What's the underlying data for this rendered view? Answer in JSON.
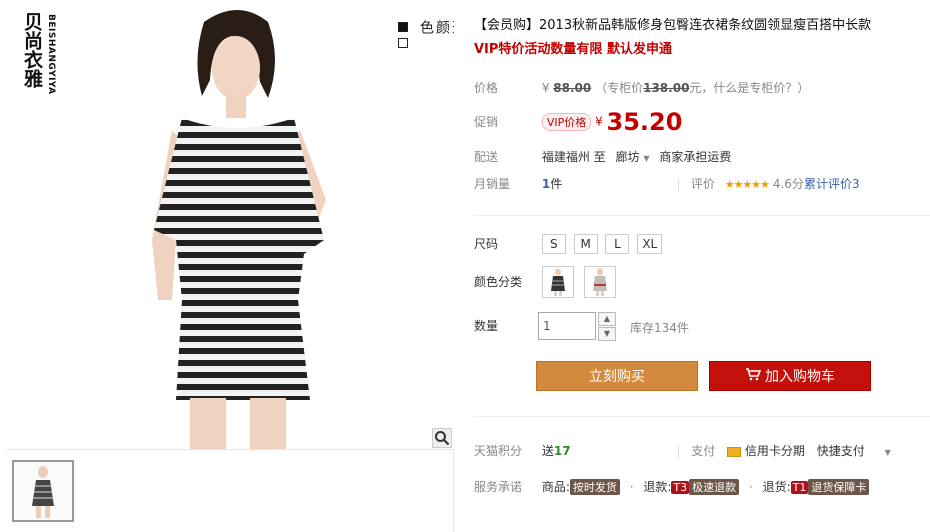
{
  "gallery": {
    "brand_cn": "贝尚衣雅",
    "brand_en": "BEISHANGYIYA",
    "option_text": "可选颜色"
  },
  "product": {
    "title": "【会员购】2013秋新品韩版修身包臀连衣裙条纹圆领显瘦百搭中长款",
    "subtitle": "VIP特价活动数量有限 默认发申通"
  },
  "price": {
    "label": "价格",
    "currency": "¥",
    "original": "88.00",
    "counter_prefix": "（专柜价",
    "counter_value": "138.00",
    "counter_suffix": "元，什么是专柜价？）"
  },
  "promo": {
    "label": "促销",
    "tag": "VIP价格",
    "currency": "¥",
    "price": "35.20"
  },
  "shipping": {
    "label": "配送",
    "from": "福建福州",
    "to_word": "至",
    "to": "廊坊",
    "fee": "商家承担运费"
  },
  "sales": {
    "label": "月销量",
    "count": "1",
    "unit": "件",
    "review_label": "评价",
    "rating": 4.6,
    "rating_text": "4.6分",
    "review_text": "累计评价3"
  },
  "size": {
    "label": "尺码",
    "options": [
      "S",
      "M",
      "L",
      "XL"
    ]
  },
  "color": {
    "label": "颜色分类"
  },
  "quantity": {
    "label": "数量",
    "value": "1",
    "stock": "库存134件"
  },
  "actions": {
    "buy": "立刻购买",
    "cart": "加入购物车"
  },
  "points": {
    "label": "天猫积分",
    "prefix": "送",
    "value": "17",
    "pay_label": "支付",
    "card": "信用卡分期",
    "quick": "快捷支付"
  },
  "service": {
    "label": "服务承诺",
    "item1_label": "商品:",
    "item1_tag": "按时发货",
    "item2_label": "退款:",
    "item2_code": "T3",
    "item2_tag": "极速退款",
    "item3_label": "退货:",
    "item3_code": "T1",
    "item3_tag": "退货保障卡"
  }
}
